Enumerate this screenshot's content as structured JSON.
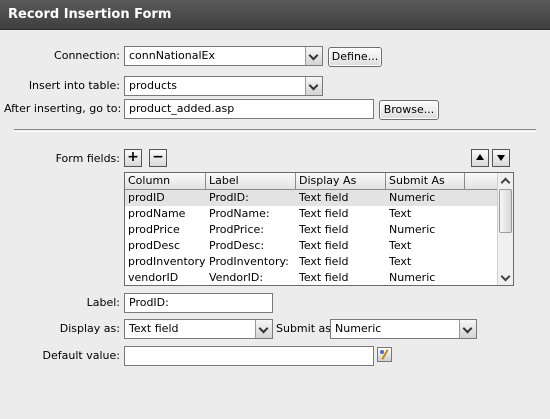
{
  "title": "Record Insertion Form",
  "connection": {
    "label": "Connection:",
    "value": "connNationalEx",
    "define_label": "Define..."
  },
  "insert_table": {
    "label": "Insert into table:",
    "value": "products"
  },
  "after_insert": {
    "label": "After inserting, go to:",
    "value": "product_added.asp",
    "browse_label": "Browse..."
  },
  "form_fields": {
    "label": "Form fields:",
    "add_symbol": "+",
    "remove_symbol": "−",
    "columns": [
      "Column",
      "Label",
      "Display As",
      "Submit As"
    ],
    "rows": [
      [
        "prodID",
        "ProdID:",
        "Text field",
        "Numeric"
      ],
      [
        "prodName",
        "ProdName:",
        "Text field",
        "Text"
      ],
      [
        "prodPrice",
        "ProdPrice:",
        "Text field",
        "Numeric"
      ],
      [
        "prodDesc",
        "ProdDesc:",
        "Text field",
        "Text"
      ],
      [
        "prodInventory",
        "ProdInventory:",
        "Text field",
        "Text"
      ],
      [
        "vendorID",
        "VendorID:",
        "Text field",
        "Numeric"
      ]
    ],
    "selected_row": 0
  },
  "field_label": {
    "label": "Label:",
    "value": "ProdID:"
  },
  "display_as": {
    "label": "Display as:",
    "value": "Text field"
  },
  "submit_as": {
    "label": "Submit as:",
    "value": "Numeric"
  },
  "default_value": {
    "label": "Default value:",
    "value": ""
  },
  "icons": {
    "move_up": "triangle-up-icon",
    "move_down": "triangle-down-icon",
    "dynamic_data": "lightning-bolt-icon"
  },
  "colors": {
    "titlebar": "#4a4a4a",
    "background": "#ececec",
    "selected_row": "#e3e3e3"
  }
}
